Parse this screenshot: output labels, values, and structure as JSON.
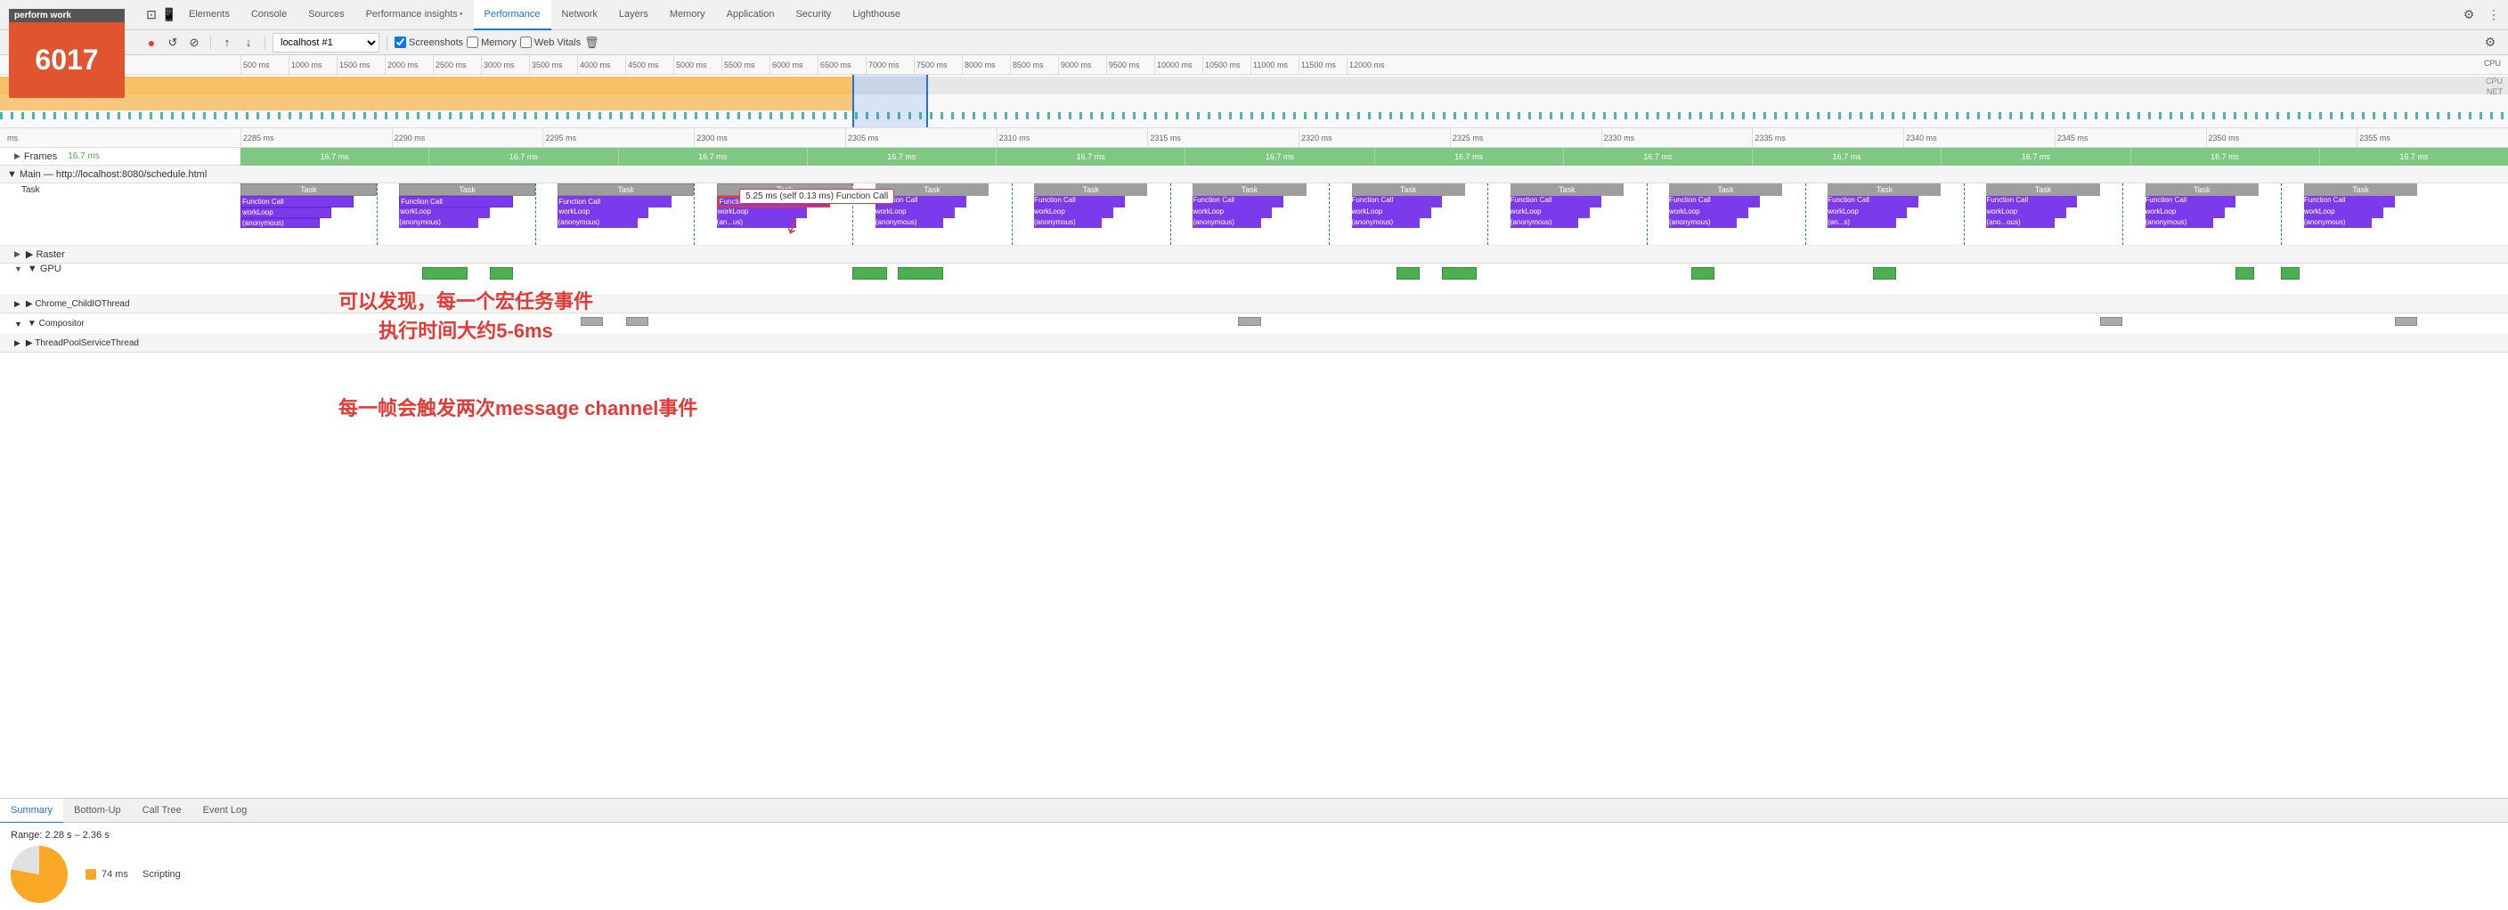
{
  "app": {
    "title": "perform work",
    "count": "6017"
  },
  "tabs": [
    {
      "label": "Elements",
      "active": false
    },
    {
      "label": "Console",
      "active": false
    },
    {
      "label": "Sources",
      "active": false
    },
    {
      "label": "Performance insights",
      "active": false,
      "hasDot": true
    },
    {
      "label": "Performance",
      "active": true
    },
    {
      "label": "Network",
      "active": false
    },
    {
      "label": "Layers",
      "active": false
    },
    {
      "label": "Memory",
      "active": false
    },
    {
      "label": "Application",
      "active": false
    },
    {
      "label": "Security",
      "active": false
    },
    {
      "label": "Lighthouse",
      "active": false
    }
  ],
  "toolbar": {
    "record_label": "●",
    "reload_label": "↺",
    "clear_label": "⊘",
    "upload_label": "↑",
    "download_label": "↓",
    "url_value": "localhost #1",
    "screenshots_label": "Screenshots",
    "memory_label": "Memory",
    "web_vitals_label": "Web Vitals"
  },
  "ruler": {
    "marks": [
      "500 ms",
      "1000 ms",
      "1500 ms",
      "2000 ms",
      "2500 ms",
      "3000 ms",
      "3500 ms",
      "4000 ms",
      "4500 ms",
      "5000 ms",
      "5500 ms",
      "6000 ms",
      "6500 ms",
      "7000 ms",
      "7500 ms",
      "8000 ms",
      "8500 ms",
      "9000 ms",
      "9500 ms",
      "10000 ms",
      "10500 ms",
      "11000 ms",
      "11500 ms",
      "12000 ms"
    ]
  },
  "zoom_ruler": {
    "label": "ms",
    "marks": [
      "2285 ms",
      "2290 ms",
      "2295 ms",
      "2300 ms",
      "2305 ms",
      "2310 ms",
      "2315 ms",
      "2320 ms",
      "2325 ms",
      "2330 ms",
      "2335 ms",
      "2340 ms",
      "2345 ms",
      "2350 ms",
      "2355 ms"
    ]
  },
  "frames": {
    "label": "Frames",
    "value": "16.7 ms",
    "repeat_value": "16.7 ms"
  },
  "main_section": {
    "title": "▼ Main — http://localhost:8080/schedule.html"
  },
  "tracks": {
    "task_label": "Task",
    "function_call_label": "Function Call",
    "work_loop_label": "workLoop",
    "anonymous_label": "(anonymous)"
  },
  "callout": {
    "text": "5.25 ms (self 0.13 ms) Function Call"
  },
  "annotations": {
    "text1": "可以发现，每一个宏任务事件",
    "text2": "执行时间大约5-6ms",
    "text3": "每一帧会触发两次message channel事件"
  },
  "raster": {
    "label": "▶ Raster"
  },
  "gpu": {
    "label": "▼ GPU"
  },
  "chrome_child": {
    "label": "▶ Chrome_ChildIOThread"
  },
  "compositor": {
    "label": "▼ Compositor"
  },
  "thread_pool": {
    "label": "▶ ThreadPoolServiceThread"
  },
  "bottom_tabs": [
    "Summary",
    "Bottom-Up",
    "Call Tree",
    "Event Log"
  ],
  "summary": {
    "range": "Range: 2.28 s – 2.36 s",
    "scripting_ms": "74 ms",
    "scripting_label": "Scripting"
  },
  "icons": {
    "settings": "⚙",
    "more": "⋮",
    "devtools_icon": "⊡"
  }
}
